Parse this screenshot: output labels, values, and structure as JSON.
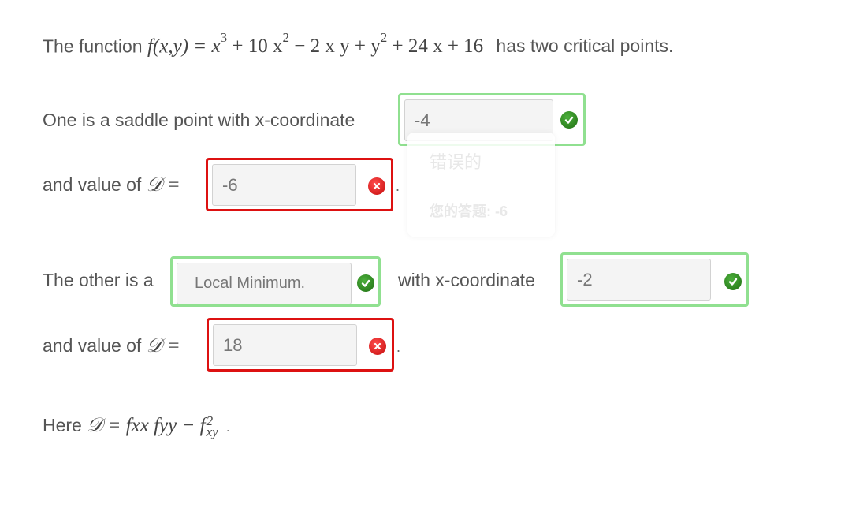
{
  "intro": {
    "before": "The function",
    "func_label": "f(x,y) =",
    "expr": {
      "t1": "x",
      "t1_exp": "3",
      "t2": "+ 10 x",
      "t2_exp": "2",
      "t3": "− 2 x y + y",
      "t3_exp": "2",
      "t4": "+ 24 x + 16"
    },
    "after": "has two critical points."
  },
  "q1": {
    "saddle_text": "One is a saddle point with x-coordinate",
    "saddle_x": {
      "value": "-4",
      "status": "correct"
    },
    "d_text": "and value of",
    "d_symbol": "𝒟 =",
    "d_value": {
      "value": "-6",
      "status": "incorrect"
    },
    "period": "."
  },
  "tooltip": {
    "title": "错误的",
    "answer_label": "您的答题:",
    "answer_value": "-6"
  },
  "q2": {
    "other_text": "The other is a",
    "type_select": {
      "value": "Local Minimum.",
      "status": "correct"
    },
    "x_text": "with x-coordinate",
    "x_value": {
      "value": "-2",
      "status": "correct"
    },
    "d_text": "and value of",
    "d_symbol": "𝒟 =",
    "d_value": {
      "value": "18",
      "status": "incorrect"
    },
    "period": "."
  },
  "footer": {
    "here": "Here",
    "d_symbol": "𝒟 =",
    "formula": "fxx fyy − f",
    "formula_sup": "2",
    "formula_sub": "xy",
    "period": "."
  },
  "colors": {
    "correct_border": "#90e090",
    "incorrect_border": "#dd1111",
    "correct_icon": "#2e8b1f",
    "incorrect_icon": "#dd1111"
  }
}
